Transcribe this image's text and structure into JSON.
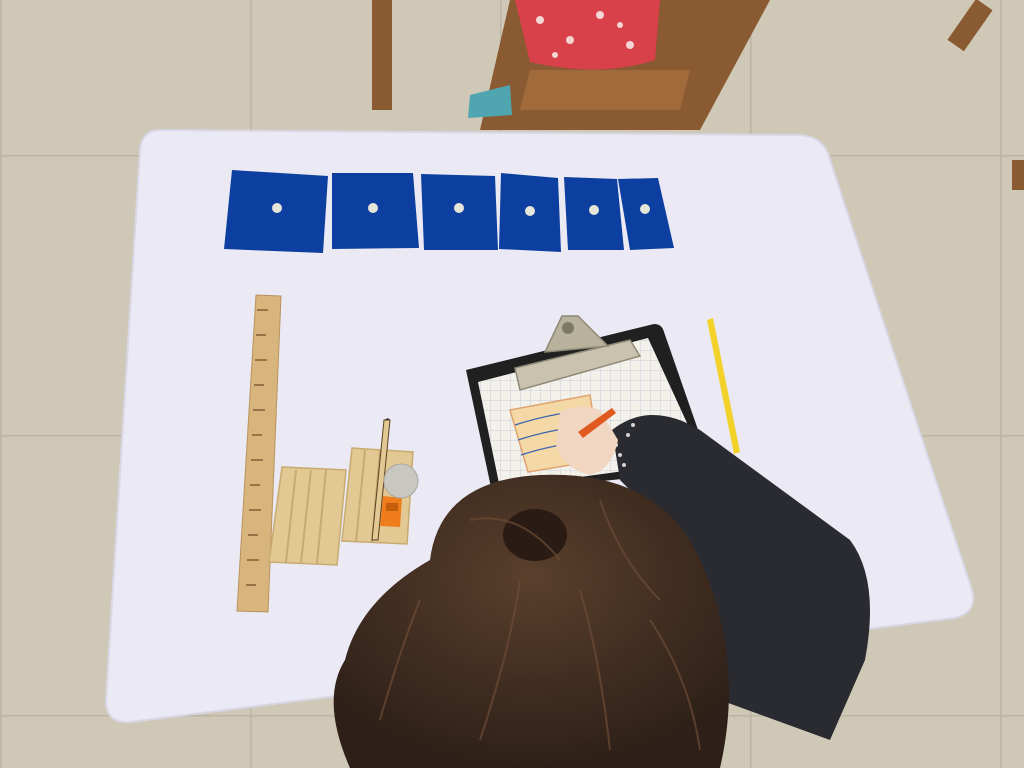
{
  "scene": {
    "colors": {
      "floor": "#cfc8b6",
      "floor_grout": "#bdb5a2",
      "table": "#ebe9f4",
      "table_edge": "#d9d7e6",
      "blue_tile": "#0c3fa0",
      "wood": "#e2c893",
      "ruler": "#d8b57c",
      "clipboard": "#202020",
      "clip_metal": "#c9c2ae",
      "paper": "#f3f1ea",
      "yellow_pencil": "#f2d22a",
      "orange": "#f07d1c",
      "hair": "#3c2a20",
      "jacket": "#2a2b30",
      "chair": "#8a5a32",
      "dress": "#d8404a"
    },
    "objects": {
      "blue_tile_count": 6
    }
  }
}
